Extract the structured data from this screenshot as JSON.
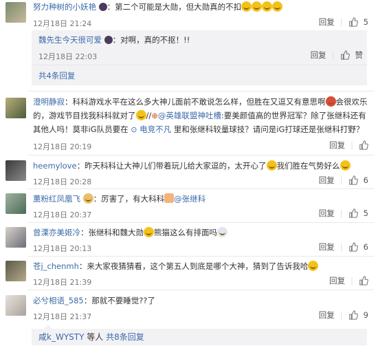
{
  "comment1": {
    "author": "努力种树的小妖艳",
    "text": "：第二个可能是大勋，但大勋真的不扣",
    "time": "12月18日 21:24",
    "reply": "回复",
    "likes": "5"
  },
  "reply1": {
    "author": "魏先生今天很可爱",
    "text": "：对啊，真的不抠！!!",
    "time": "12月18日 22:03",
    "reply": "回复",
    "like": "赞",
    "more": "共4条回复"
  },
  "comment2": {
    "author": "澄明静寂",
    "text_a": "：科科游戏水平在这么多大神儿面前不敢说怎么样，但胜在又逗又有意思啊",
    "text_b": "会很欢乐的，游戏节目找我科科就对了",
    "text_c": "//",
    "mention": "@英雄联盟神吐槽",
    "text_d": ":要美颜值高的世界冠军？除了张继科还有其他人吗！莫非iG队员要在",
    "link": "电竞不凡",
    "text_e": "里和张继科较量球技？请问是iG打球还是张继科打野？",
    "time": "12月18日 20:19",
    "reply": "回复"
  },
  "comment3": {
    "author": "heemylove",
    "text_a": "：昨天科科让大神儿们带着玩儿给大家逗的，太开心了",
    "text_b": "我们胜在气势好么",
    "time": "12月18日 20:28",
    "reply": "回复",
    "likes": "6"
  },
  "comment4": {
    "author": "薰粉红凤凰飞",
    "text": "：厉害了，有大科科",
    "mention": "@张继科",
    "time": "12月18日 20:37",
    "reply": "回复",
    "likes": "5"
  },
  "comment5": {
    "author": "曾溧亦美姬冷",
    "text_a": "：张继科和魏大勋",
    "text_b": "熊猫这么有排面吗",
    "time": "12月18日 20:13",
    "reply": "回复",
    "likes": "6"
  },
  "comment6": {
    "author": "苍j_chenmh",
    "text": "：来大家夜猜猜看，这个第五人到底是哪个大神，猜到了告诉我哈",
    "time": "12月18日 21:39",
    "reply": "回复"
  },
  "comment7": {
    "author": "必兮相语_585",
    "text": "：那就不要睡觉??了",
    "time": "12月18日 21:37",
    "reply": "回复",
    "likes": "9"
  },
  "footer": {
    "author": "咸k_WYSTY",
    "text": "等人",
    "more": "共8条回复"
  }
}
